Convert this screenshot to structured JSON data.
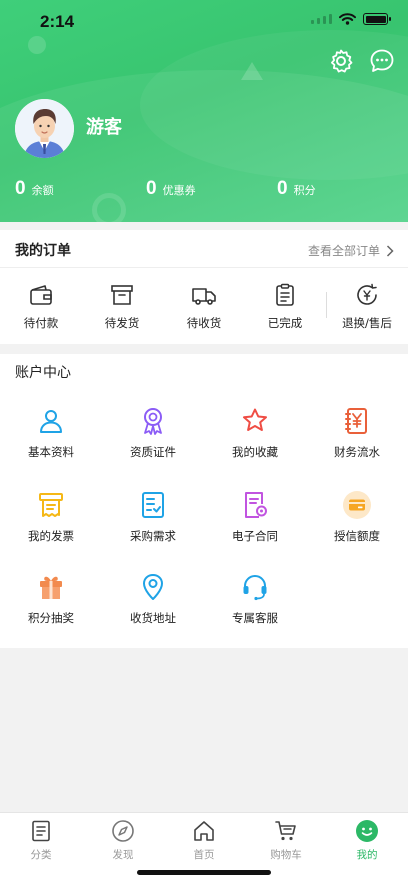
{
  "status": {
    "time": "2:14"
  },
  "profile": {
    "username": "游客"
  },
  "stats": [
    {
      "value": "0",
      "label": "余额"
    },
    {
      "value": "0",
      "label": "优惠券"
    },
    {
      "value": "0",
      "label": "积分"
    }
  ],
  "orders": {
    "title": "我的订单",
    "view_all": "查看全部订单",
    "items": [
      {
        "label": "待付款",
        "icon": "wallet-icon"
      },
      {
        "label": "待发货",
        "icon": "box-icon"
      },
      {
        "label": "待收货",
        "icon": "truck-icon"
      },
      {
        "label": "已完成",
        "icon": "clipboard-icon"
      },
      {
        "label": "退换/售后",
        "icon": "refund-icon"
      }
    ]
  },
  "account": {
    "title": "账户中心",
    "items": [
      {
        "label": "基本资料",
        "icon": "user-icon"
      },
      {
        "label": "资质证件",
        "icon": "badge-icon"
      },
      {
        "label": "我的收藏",
        "icon": "star-icon"
      },
      {
        "label": "财务流水",
        "icon": "ledger-icon"
      },
      {
        "label": "我的发票",
        "icon": "invoice-icon"
      },
      {
        "label": "采购需求",
        "icon": "checklist-icon"
      },
      {
        "label": "电子合同",
        "icon": "contract-icon"
      },
      {
        "label": "授信额度",
        "icon": "credit-card-icon"
      },
      {
        "label": "积分抽奖",
        "icon": "gift-icon"
      },
      {
        "label": "收货地址",
        "icon": "location-icon"
      },
      {
        "label": "专属客服",
        "icon": "headset-icon"
      }
    ]
  },
  "tabbar": {
    "items": [
      {
        "label": "分类",
        "icon": "category-icon"
      },
      {
        "label": "发现",
        "icon": "compass-icon"
      },
      {
        "label": "首页",
        "icon": "home-icon"
      },
      {
        "label": "购物车",
        "icon": "cart-icon"
      },
      {
        "label": "我的",
        "icon": "smiley-icon"
      }
    ],
    "active": "我的"
  },
  "colors": {
    "brand_green": "#3fcf7a",
    "active_tab": "#2cb866"
  }
}
